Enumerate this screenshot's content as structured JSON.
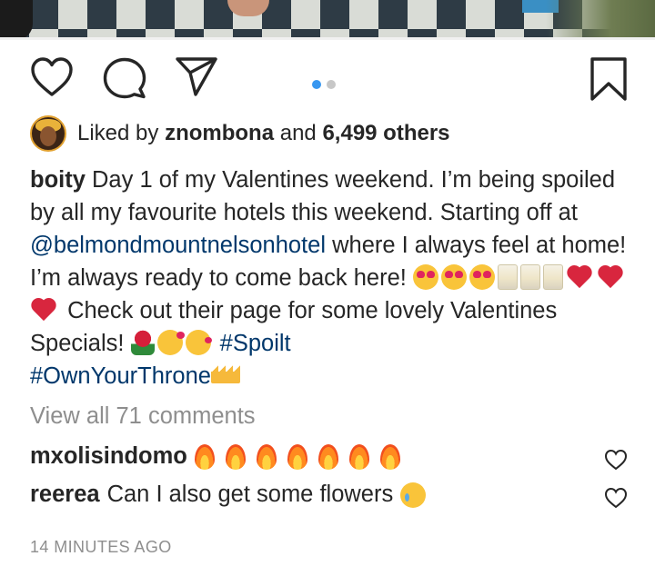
{
  "post": {
    "actions": {
      "like_icon": "heart-outline",
      "comment_icon": "speech-bubble",
      "share_icon": "paper-plane",
      "save_icon": "bookmark-outline"
    },
    "carousel": {
      "active_index": 0,
      "count": 2,
      "active_color": "#3897f0",
      "inactive_color": "#c7c7c7"
    }
  },
  "likes": {
    "prefix": "Liked by ",
    "user": "znombona",
    "middle": " and ",
    "others": "6,499 others"
  },
  "caption": {
    "username": "boity",
    "text1": " Day 1 of my Valentines weekend. I’m being spoiled by all my favourite hotels this weekend. Starting off at ",
    "mention": "@belmondmountnelsonhotel",
    "text2": " where I always feel at home! I’m always ready to come back here! ",
    "text3": " Check out their page for some lovely Valentines Specials! ",
    "hashtag1": "#Spoilt",
    "hashtag2": "#OwnYourThrone"
  },
  "view_all": "View all 71 comments",
  "comments": [
    {
      "username": "mxolisindomo",
      "text": ""
    },
    {
      "username": "reerea",
      "text": "Can I also get some flowers"
    }
  ],
  "timestamp": "14 MINUTES AGO",
  "colors": {
    "link": "#00376b",
    "muted": "#8e8e8e",
    "text": "#262626"
  }
}
